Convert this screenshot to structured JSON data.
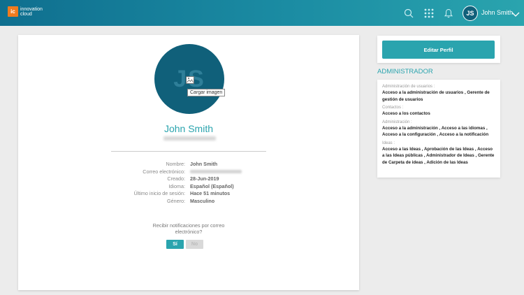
{
  "brand": {
    "logo_mark": "ic",
    "name_line1": "innovation",
    "name_line2": "cloud",
    "accent": "#2aa4ae",
    "logo_color": "#f07b1f"
  },
  "header": {
    "user_initials": "JS",
    "user_name": "John Smith",
    "icons": [
      "search-icon",
      "apps-grid-icon",
      "bell-icon",
      "chevron-down-icon"
    ]
  },
  "profile": {
    "initials": "JS",
    "upload_tooltip": "Cargar imagen",
    "name": "John Smith",
    "fields": [
      {
        "label": "Nombre:",
        "value": "John Smith"
      },
      {
        "label": "Correo electrónico:",
        "value": ""
      },
      {
        "label": "Creado:",
        "value": "28-Jun-2019"
      },
      {
        "label": "Idioma:",
        "value": "Español (Español)"
      },
      {
        "label": "Último inicio de sesión:",
        "value": "Hace 51 minutos"
      },
      {
        "label": "Género:",
        "value": "Masculino"
      }
    ],
    "notifications_question": "Recibir notificaciones por correo electrónico?",
    "yes_label": "Sí",
    "no_label": "No"
  },
  "sidebar": {
    "edit_button": "Editar Perfil",
    "admin_title": "ADMINISTRADOR",
    "groups": [
      {
        "label": "Administración de usuarios :",
        "value": "Acceso a la administración de usuarios , Gerente de gestión de usuarios"
      },
      {
        "label": "Contactos :",
        "value": "Acceso a los contactos"
      },
      {
        "label": "Administración :",
        "value": "Acceso a la administración , Acceso a las idiomas , Acceso a la configuración , Acceso a la notificación"
      },
      {
        "label": "Ideas :",
        "value": "Acceso a las Ideas , Aprobación de las Ideas , Acceso a las Ideas públicas , Administrador de Ideas , Gerente de Carpeta de ideas , Adición de las Ideas"
      }
    ]
  }
}
